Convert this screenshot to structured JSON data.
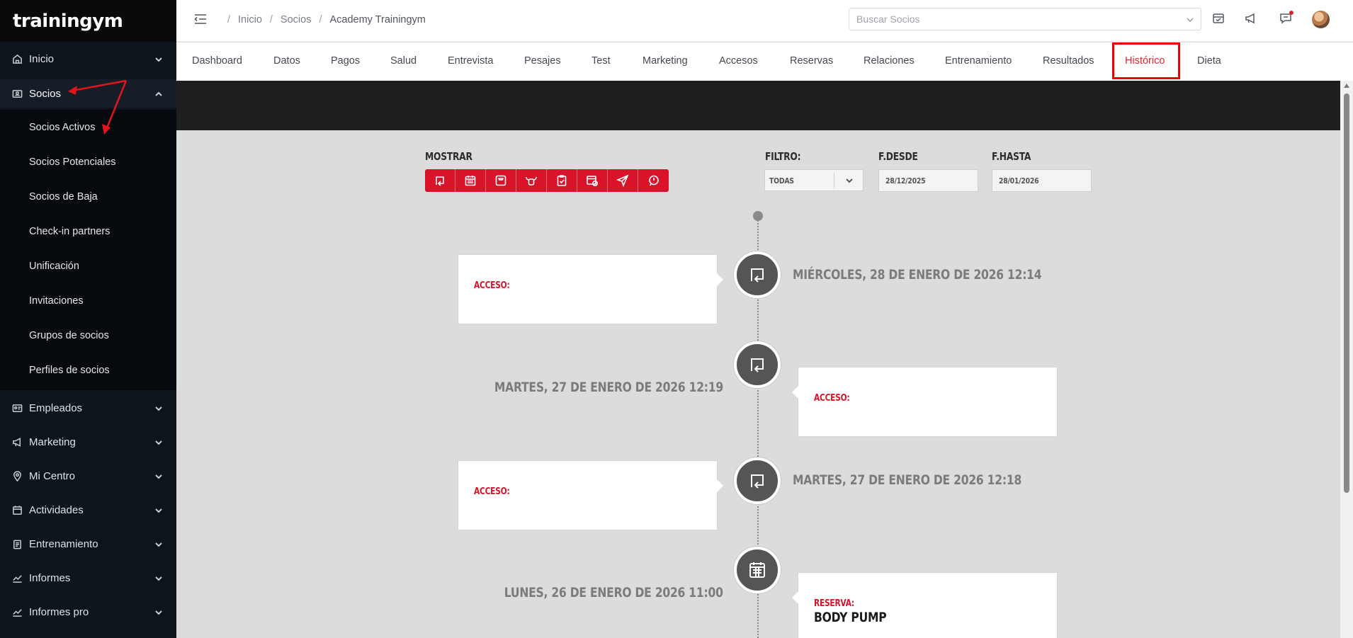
{
  "app": {
    "logo": "trainingym"
  },
  "sidebar": {
    "items": [
      {
        "label": "Inicio",
        "icon": "home-icon"
      },
      {
        "label": "Socios",
        "icon": "members-icon"
      },
      {
        "label": "Empleados",
        "icon": "id-card-icon"
      },
      {
        "label": "Marketing",
        "icon": "megaphone-icon"
      },
      {
        "label": "Mi Centro",
        "icon": "location-pin-icon"
      },
      {
        "label": "Actividades",
        "icon": "calendar-icon"
      },
      {
        "label": "Entrenamiento",
        "icon": "clipboard-icon"
      },
      {
        "label": "Informes",
        "icon": "trend-chart-icon"
      },
      {
        "label": "Informes pro",
        "icon": "trend-chart-icon"
      }
    ],
    "submenu": [
      {
        "label": "Socios Activos"
      },
      {
        "label": "Socios Potenciales"
      },
      {
        "label": "Socios de Baja"
      },
      {
        "label": "Check-in partners"
      },
      {
        "label": "Unificación"
      },
      {
        "label": "Invitaciones"
      },
      {
        "label": "Grupos de socios"
      },
      {
        "label": "Perfiles de socios"
      }
    ]
  },
  "header": {
    "breadcrumb": [
      "Inicio",
      "Socios",
      "Academy Trainingym"
    ],
    "search_placeholder": "Buscar Socios"
  },
  "tabs": [
    "Dashboard",
    "Datos",
    "Pagos",
    "Salud",
    "Entrevista",
    "Pesajes",
    "Test",
    "Marketing",
    "Accesos",
    "Reservas",
    "Relaciones",
    "Entrenamiento",
    "Resultados",
    "Histórico",
    "Dieta"
  ],
  "active_tab": "Histórico",
  "filters": {
    "show_label": "MOSTRAR",
    "show_buttons": [
      "access-icon",
      "calendar-icon",
      "scale-icon",
      "bull-icon",
      "clipboard-check-icon",
      "calendar-check-icon",
      "send-icon",
      "alert-circle-icon"
    ],
    "filter_label": "FILTRO:",
    "filter_value": "TODAS",
    "from_label": "F.DESDE",
    "from_value": "28/12/2025",
    "to_label": "F.HASTA",
    "to_value": "28/01/2026"
  },
  "timeline": [
    {
      "date": "MIÉRCOLES, 28 DE ENERO DE 2026 12:14",
      "type": "ACCESO:",
      "name": "",
      "icon": "access-icon"
    },
    {
      "date": "MARTES, 27 DE ENERO DE 2026 12:19",
      "type": "ACCESO:",
      "name": "",
      "icon": "access-icon"
    },
    {
      "date": "MARTES, 27 DE ENERO DE 2026 12:18",
      "type": "ACCESO:",
      "name": "",
      "icon": "access-icon"
    },
    {
      "date": "LUNES, 26 DE ENERO DE 2026 11:00",
      "type": "RESERVA:",
      "name": "BODY PUMP",
      "icon": "calendar-icon"
    }
  ],
  "colors": {
    "accent": "#d9142a",
    "sidebar_bg": "#0e141c",
    "active_tab": "#e8232f"
  }
}
